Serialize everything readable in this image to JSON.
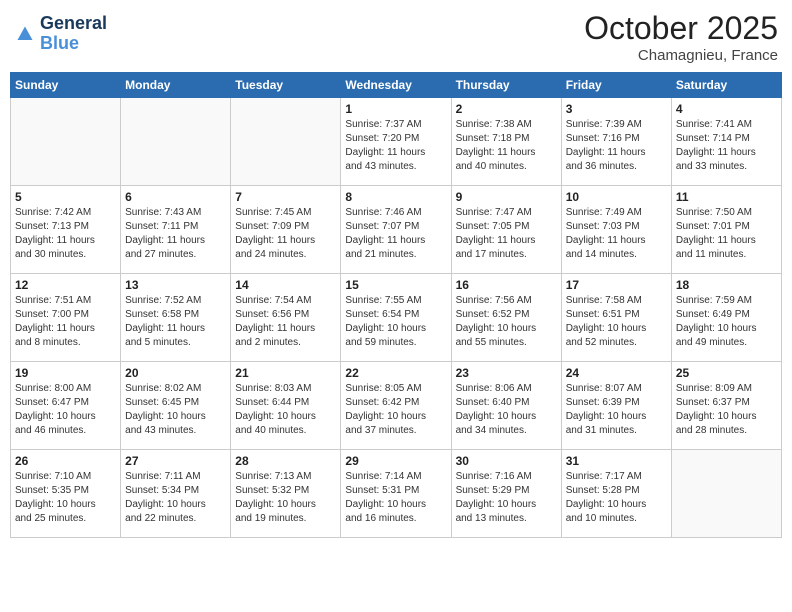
{
  "header": {
    "logo_line1": "General",
    "logo_line2": "Blue",
    "month": "October 2025",
    "location": "Chamagnieu, France"
  },
  "weekdays": [
    "Sunday",
    "Monday",
    "Tuesday",
    "Wednesday",
    "Thursday",
    "Friday",
    "Saturday"
  ],
  "weeks": [
    [
      {
        "day": "",
        "info": ""
      },
      {
        "day": "",
        "info": ""
      },
      {
        "day": "",
        "info": ""
      },
      {
        "day": "1",
        "info": "Sunrise: 7:37 AM\nSunset: 7:20 PM\nDaylight: 11 hours\nand 43 minutes."
      },
      {
        "day": "2",
        "info": "Sunrise: 7:38 AM\nSunset: 7:18 PM\nDaylight: 11 hours\nand 40 minutes."
      },
      {
        "day": "3",
        "info": "Sunrise: 7:39 AM\nSunset: 7:16 PM\nDaylight: 11 hours\nand 36 minutes."
      },
      {
        "day": "4",
        "info": "Sunrise: 7:41 AM\nSunset: 7:14 PM\nDaylight: 11 hours\nand 33 minutes."
      }
    ],
    [
      {
        "day": "5",
        "info": "Sunrise: 7:42 AM\nSunset: 7:13 PM\nDaylight: 11 hours\nand 30 minutes."
      },
      {
        "day": "6",
        "info": "Sunrise: 7:43 AM\nSunset: 7:11 PM\nDaylight: 11 hours\nand 27 minutes."
      },
      {
        "day": "7",
        "info": "Sunrise: 7:45 AM\nSunset: 7:09 PM\nDaylight: 11 hours\nand 24 minutes."
      },
      {
        "day": "8",
        "info": "Sunrise: 7:46 AM\nSunset: 7:07 PM\nDaylight: 11 hours\nand 21 minutes."
      },
      {
        "day": "9",
        "info": "Sunrise: 7:47 AM\nSunset: 7:05 PM\nDaylight: 11 hours\nand 17 minutes."
      },
      {
        "day": "10",
        "info": "Sunrise: 7:49 AM\nSunset: 7:03 PM\nDaylight: 11 hours\nand 14 minutes."
      },
      {
        "day": "11",
        "info": "Sunrise: 7:50 AM\nSunset: 7:01 PM\nDaylight: 11 hours\nand 11 minutes."
      }
    ],
    [
      {
        "day": "12",
        "info": "Sunrise: 7:51 AM\nSunset: 7:00 PM\nDaylight: 11 hours\nand 8 minutes."
      },
      {
        "day": "13",
        "info": "Sunrise: 7:52 AM\nSunset: 6:58 PM\nDaylight: 11 hours\nand 5 minutes."
      },
      {
        "day": "14",
        "info": "Sunrise: 7:54 AM\nSunset: 6:56 PM\nDaylight: 11 hours\nand 2 minutes."
      },
      {
        "day": "15",
        "info": "Sunrise: 7:55 AM\nSunset: 6:54 PM\nDaylight: 10 hours\nand 59 minutes."
      },
      {
        "day": "16",
        "info": "Sunrise: 7:56 AM\nSunset: 6:52 PM\nDaylight: 10 hours\nand 55 minutes."
      },
      {
        "day": "17",
        "info": "Sunrise: 7:58 AM\nSunset: 6:51 PM\nDaylight: 10 hours\nand 52 minutes."
      },
      {
        "day": "18",
        "info": "Sunrise: 7:59 AM\nSunset: 6:49 PM\nDaylight: 10 hours\nand 49 minutes."
      }
    ],
    [
      {
        "day": "19",
        "info": "Sunrise: 8:00 AM\nSunset: 6:47 PM\nDaylight: 10 hours\nand 46 minutes."
      },
      {
        "day": "20",
        "info": "Sunrise: 8:02 AM\nSunset: 6:45 PM\nDaylight: 10 hours\nand 43 minutes."
      },
      {
        "day": "21",
        "info": "Sunrise: 8:03 AM\nSunset: 6:44 PM\nDaylight: 10 hours\nand 40 minutes."
      },
      {
        "day": "22",
        "info": "Sunrise: 8:05 AM\nSunset: 6:42 PM\nDaylight: 10 hours\nand 37 minutes."
      },
      {
        "day": "23",
        "info": "Sunrise: 8:06 AM\nSunset: 6:40 PM\nDaylight: 10 hours\nand 34 minutes."
      },
      {
        "day": "24",
        "info": "Sunrise: 8:07 AM\nSunset: 6:39 PM\nDaylight: 10 hours\nand 31 minutes."
      },
      {
        "day": "25",
        "info": "Sunrise: 8:09 AM\nSunset: 6:37 PM\nDaylight: 10 hours\nand 28 minutes."
      }
    ],
    [
      {
        "day": "26",
        "info": "Sunrise: 7:10 AM\nSunset: 5:35 PM\nDaylight: 10 hours\nand 25 minutes."
      },
      {
        "day": "27",
        "info": "Sunrise: 7:11 AM\nSunset: 5:34 PM\nDaylight: 10 hours\nand 22 minutes."
      },
      {
        "day": "28",
        "info": "Sunrise: 7:13 AM\nSunset: 5:32 PM\nDaylight: 10 hours\nand 19 minutes."
      },
      {
        "day": "29",
        "info": "Sunrise: 7:14 AM\nSunset: 5:31 PM\nDaylight: 10 hours\nand 16 minutes."
      },
      {
        "day": "30",
        "info": "Sunrise: 7:16 AM\nSunset: 5:29 PM\nDaylight: 10 hours\nand 13 minutes."
      },
      {
        "day": "31",
        "info": "Sunrise: 7:17 AM\nSunset: 5:28 PM\nDaylight: 10 hours\nand 10 minutes."
      },
      {
        "day": "",
        "info": ""
      }
    ]
  ]
}
